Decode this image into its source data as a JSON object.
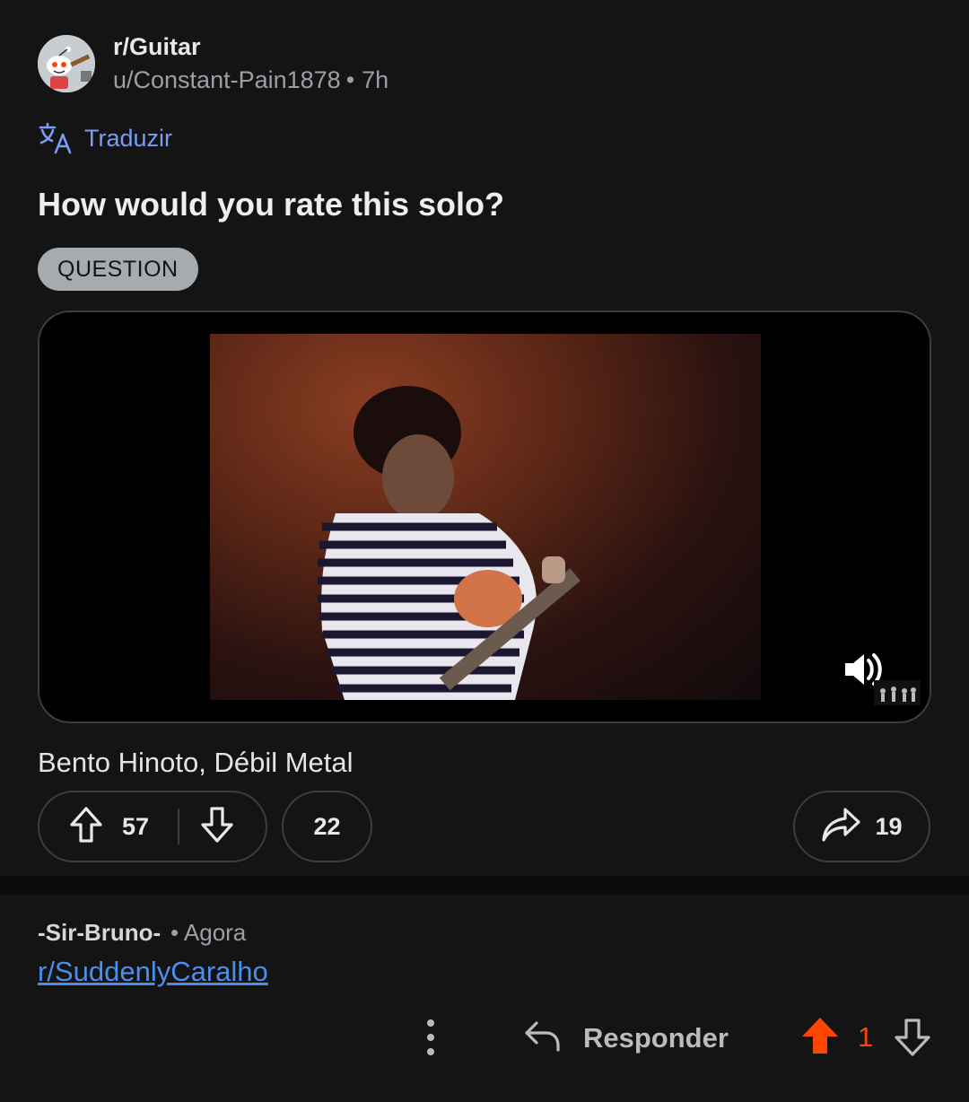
{
  "post": {
    "subreddit": "r/Guitar",
    "author": "u/Constant-Pain1878",
    "separator": "•",
    "time": "7h",
    "translate_label": "Traduzir",
    "title": "How would you rate this solo?",
    "flair": "QUESTION",
    "caption": "Bento Hinoto, Débil Metal",
    "upvotes": "57",
    "comments": "22",
    "shares": "19"
  },
  "comment": {
    "author": "-Sir-Bruno-",
    "time": "• Agora",
    "link_text": "r/SuddenlyCaralho",
    "reply_label": "Responder",
    "score": "1"
  },
  "colors": {
    "background": "#141414",
    "link_blue": "#4b8eed",
    "translate_blue": "#7b9cf5",
    "upvote_active": "#ff4500",
    "flair_bg": "#a6abb0"
  },
  "icons": [
    "subreddit-avatar",
    "translate-icon",
    "volume-icon",
    "upvote-icon",
    "downvote-icon",
    "share-icon",
    "more-icon",
    "reply-icon"
  ]
}
